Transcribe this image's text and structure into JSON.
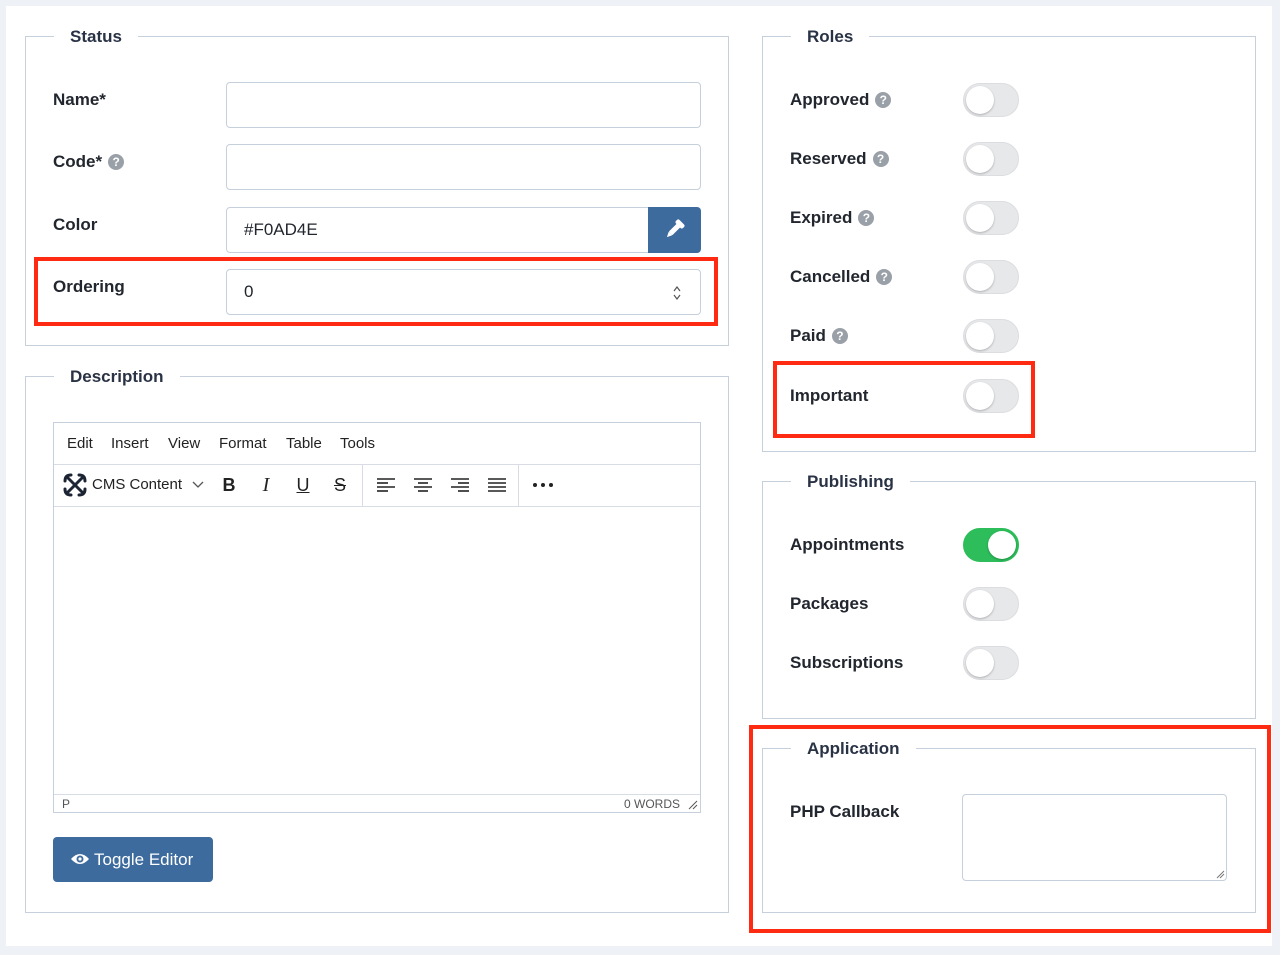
{
  "status": {
    "legend": "Status",
    "name_label": "Name*",
    "name_value": "",
    "code_label": "Code*",
    "code_value": "",
    "color_label": "Color",
    "color_value": "#F0AD4E",
    "ordering_label": "Ordering",
    "ordering_value": "0"
  },
  "description": {
    "legend": "Description",
    "menu": [
      "Edit",
      "Insert",
      "View",
      "Format",
      "Table",
      "Tools"
    ],
    "format_select": "CMS Content",
    "statusbar_path": "P",
    "statusbar_words": "0 WORDS",
    "toggle_editor": "Toggle Editor",
    "icons": [
      "cms-logo-icon",
      "chevron-down-icon",
      "bold-icon",
      "italic-icon",
      "underline-icon",
      "strikethrough-icon",
      "align-left-icon",
      "align-center-icon",
      "align-right-icon",
      "align-justify-icon",
      "more-icon",
      "eye-icon",
      "resize-handle-icon"
    ]
  },
  "roles": {
    "legend": "Roles",
    "items": [
      {
        "label": "Approved",
        "help": true,
        "on": false
      },
      {
        "label": "Reserved",
        "help": true,
        "on": false
      },
      {
        "label": "Expired",
        "help": true,
        "on": false
      },
      {
        "label": "Cancelled",
        "help": true,
        "on": false
      },
      {
        "label": "Paid",
        "help": true,
        "on": false
      },
      {
        "label": "Important",
        "help": false,
        "on": false
      }
    ]
  },
  "publishing": {
    "legend": "Publishing",
    "items": [
      {
        "label": "Appointments",
        "on": true
      },
      {
        "label": "Packages",
        "on": false
      },
      {
        "label": "Subscriptions",
        "on": false
      }
    ]
  },
  "application": {
    "legend": "Application",
    "php_callback_label": "PHP Callback",
    "php_callback_value": ""
  },
  "colors": {
    "accent_button": "#3d6b9e",
    "toggle_on": "#2dbd5a",
    "toggle_off": "#e7e8ea",
    "highlight": "#ff2a12"
  }
}
